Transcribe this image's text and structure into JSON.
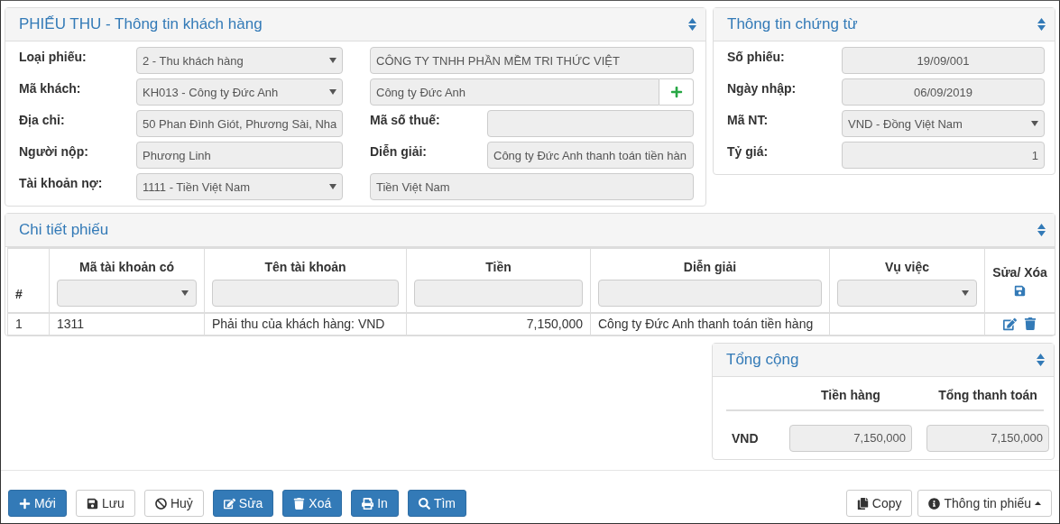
{
  "customer_panel": {
    "title": "PHIẾU THU - Thông tin khách hàng",
    "rows": [
      {
        "left": {
          "label": "Loại phiếu:",
          "kind": "select",
          "value": "2 - Thu khách hàng"
        },
        "right": {
          "kind": "text",
          "value": "CÔNG TY TNHH PHẦN MỀM TRI THỨC VIỆT"
        }
      },
      {
        "left": {
          "label": "Mã khách:",
          "kind": "select",
          "value": "KH013 - Công ty Đức Anh"
        },
        "right": {
          "kind": "text-add",
          "value": "Công ty Đức Anh"
        }
      },
      {
        "left": {
          "label": "Địa chỉ:",
          "kind": "text",
          "value": "50 Phan Đình Giót, Phương Sài, Nha"
        },
        "right": {
          "label": "Mã số thuế:",
          "kind": "text"
        }
      },
      {
        "left": {
          "label": "Người nộp:",
          "kind": "text",
          "value": "Phương Linh"
        },
        "right": {
          "label": "Diễn giải:",
          "kind": "text",
          "value": "Công ty Đức Anh thanh toán tiền hàn"
        }
      },
      {
        "left": {
          "label": "Tài khoản nợ:",
          "kind": "select",
          "value": "1111 - Tiền Việt Nam"
        },
        "right": {
          "kind": "text",
          "value": "Tiền Việt Nam"
        }
      }
    ]
  },
  "voucher_panel": {
    "title": "Thông tin chứng từ",
    "fields": [
      {
        "label": "Số phiếu:",
        "kind": "text",
        "value": "19/09/001"
      },
      {
        "label": "Ngày nhập:",
        "kind": "text",
        "value": "06/09/2019"
      },
      {
        "label": "Mã NT:",
        "kind": "select",
        "value": "VND - Đồng Việt Nam"
      },
      {
        "label": "Tỷ giá:",
        "kind": "text",
        "value": "1"
      }
    ]
  },
  "detail_panel": {
    "title": "Chi tiết phiếu",
    "columns": [
      {
        "label": "#",
        "kind": "plain"
      },
      {
        "label": "Mã tài khoản có",
        "kind": "dropdown"
      },
      {
        "label": "Tên tài khoản",
        "kind": "input"
      },
      {
        "label": "Tiền",
        "kind": "input"
      },
      {
        "label": "Diễn giải",
        "kind": "input"
      },
      {
        "label": "Vụ việc",
        "kind": "dropdown"
      },
      {
        "label": "Sửa/ Xóa",
        "kind": "save"
      }
    ],
    "rows": [
      {
        "cells": [
          "1",
          "1311",
          "Phải thu của khách hàng: VND",
          "7,150,000",
          "Công ty Đức Anh thanh toán tiền hàng",
          ""
        ],
        "actions": true
      }
    ]
  },
  "totals_panel": {
    "title": "Tổng cộng",
    "columns": [
      "Tiền hàng",
      "Tổng thanh toán"
    ],
    "rows": [
      {
        "currency": "VND",
        "values": [
          "7,150,000",
          "7,150,000"
        ]
      }
    ]
  },
  "footer": {
    "left_buttons": [
      {
        "label": "Mới",
        "kind": "new"
      },
      {
        "label": "Lưu",
        "kind": "save"
      },
      {
        "label": "Huỷ",
        "kind": "cancel"
      },
      {
        "label": "Sửa",
        "kind": "edit"
      },
      {
        "label": "Xoá",
        "kind": "delete"
      },
      {
        "label": "In",
        "kind": "print"
      },
      {
        "label": "Tìm",
        "kind": "search"
      }
    ],
    "right_buttons": [
      {
        "label": "Copy",
        "kind": "copy"
      },
      {
        "label": "Thông tin phiếu",
        "kind": "info",
        "caret": true
      }
    ]
  }
}
